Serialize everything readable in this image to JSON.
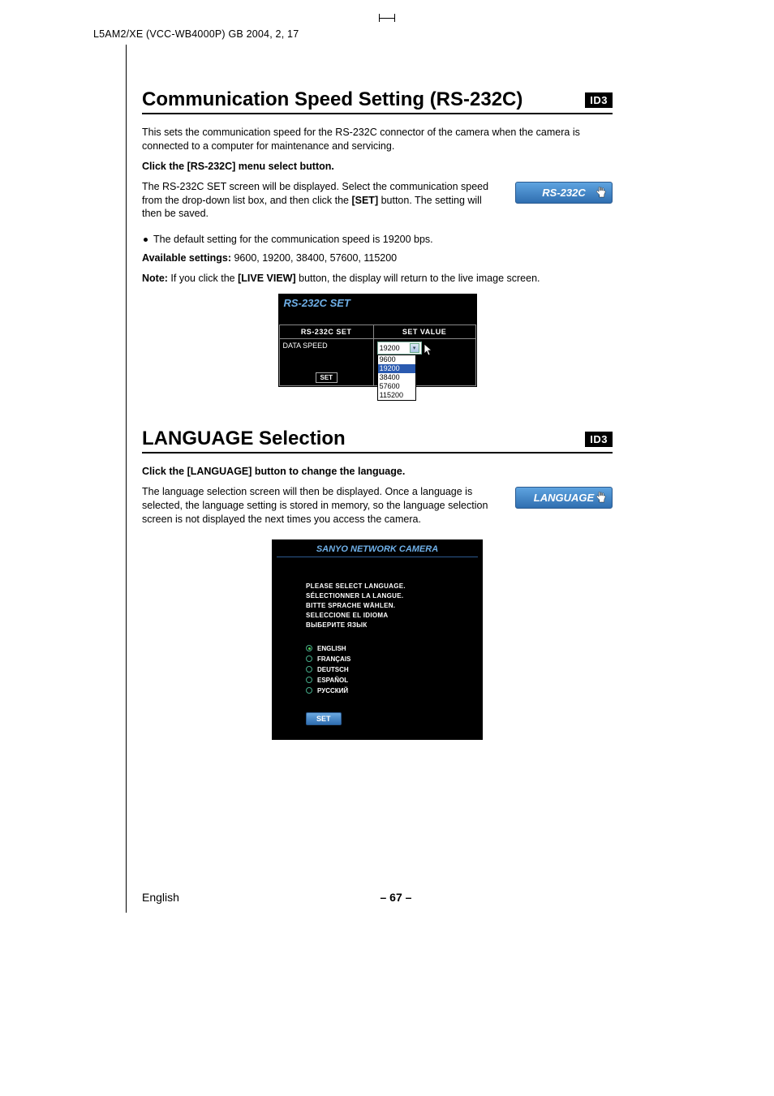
{
  "header": "L5AM2/XE (VCC-WB4000P)    GB    2004, 2, 17",
  "section1": {
    "heading": "Communication Speed Setting (RS-232C)",
    "badge": "ID3",
    "intro": "This sets the communication speed for the RS-232C connector of the camera when the camera is connected to a computer for maintenance and servicing.",
    "step_bold": "Click the [RS-232C] menu select button.",
    "step_body_prefix": "The RS-232C SET screen will be displayed. Select the communication speed from the drop-down list box, and then click the ",
    "step_body_bold": "[SET]",
    "step_body_suffix": " button. The setting will then be saved.",
    "button_label": "RS-232C",
    "bullet": "The default setting for the communication speed is 19200 bps.",
    "avail_label": "Available settings:",
    "avail_values": " 9600, 19200, 38400, 57600, 115200",
    "note_label": "Note:",
    "note_prefix": " If you click the ",
    "note_bold": "[LIVE VIEW]",
    "note_suffix": " button, the display will return to the live image screen.",
    "rs_screen": {
      "title": "RS-232C SET",
      "col1": "RS-232C SET",
      "col2": "SET VALUE",
      "row_label": "DATA SPEED",
      "selected": "19200",
      "options": [
        "9600",
        "19200",
        "38400",
        "57600",
        "115200"
      ],
      "set_btn": "SET"
    }
  },
  "section2": {
    "heading": "LANGUAGE Selection",
    "badge": "ID3",
    "step_bold": "Click the [LANGUAGE] button to change the language.",
    "body": "The language selection screen will then be displayed. Once a language is selected, the language setting is stored in memory, so the language selection screen is not displayed the next times you access the camera.",
    "button_label": "LANGUAGE",
    "lang_screen": {
      "title": "SANYO NETWORK CAMERA",
      "prompts": [
        "PLEASE SELECT LANGUAGE.",
        "SÉLECTIONNER LA LANGUE.",
        "BITTE SPRACHE WÄHLEN.",
        "SELECCIONE EL IDIOMA",
        "ВЫБЕРИТЕ ЯЗЫК"
      ],
      "options": [
        "ENGLISH",
        "FRANÇAIS",
        "DEUTSCH",
        "ESPAÑOL",
        "РУССКИЙ"
      ],
      "selected_index": 0,
      "set_btn": "SET"
    }
  },
  "footer": {
    "left": "English",
    "center": "– 67 –"
  },
  "chart_data": {
    "type": "table",
    "title": "RS-232C SET",
    "columns": [
      "RS-232C SET",
      "SET VALUE"
    ],
    "rows": [
      {
        "RS-232C SET": "DATA SPEED",
        "SET VALUE": "19200"
      }
    ],
    "dropdown_options": [
      "9600",
      "19200",
      "38400",
      "57600",
      "115200"
    ]
  }
}
